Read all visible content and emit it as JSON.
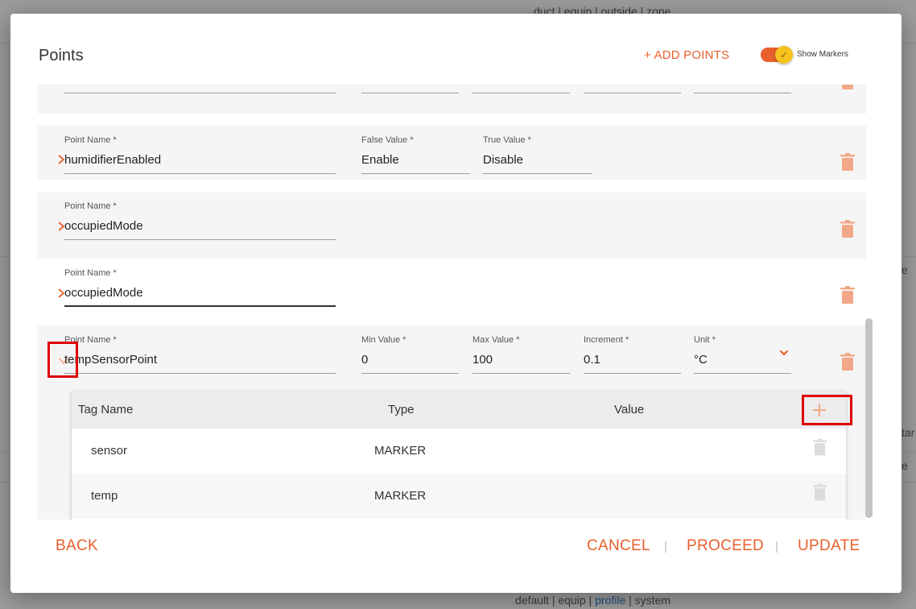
{
  "background": {
    "top_text": "duct | equip | outside | zone",
    "bottom_text_1": "default | equip | ",
    "bottom_link": "profile",
    "bottom_text_2": " | system",
    "right_fragment_1": "e",
    "right_fragment_2": "tar",
    "right_fragment_3": "e"
  },
  "modal": {
    "title": "Points",
    "add_points_label": "+ ADD POINTS",
    "show_markers_label": "Show Markers",
    "show_markers_on": true
  },
  "rows": [
    {
      "name_label": "Point Name *",
      "name_value": "humidifierEnabled",
      "false_label": "False Value *",
      "false_value": "Enable",
      "true_label": "True Value *",
      "true_value": "Disable"
    },
    {
      "name_label": "Point Name *",
      "name_value": "occupiedMode"
    },
    {
      "name_label": "Point Name *",
      "name_value": "occupiedMode"
    },
    {
      "name_label": "Point Name *",
      "name_value": "tempSensorPoint",
      "min_label": "Min Value *",
      "min_value": "0",
      "max_label": "Max Value *",
      "max_value": "100",
      "inc_label": "Increment *",
      "inc_value": "0.1",
      "unit_label": "Unit *",
      "unit_value": "°C"
    }
  ],
  "tag_table": {
    "headers": {
      "name": "Tag Name",
      "type": "Type",
      "value": "Value"
    },
    "tags": [
      {
        "name": "sensor",
        "type": "MARKER"
      },
      {
        "name": "temp",
        "type": "MARKER"
      }
    ]
  },
  "footer": {
    "back": "BACK",
    "cancel": "CANCEL",
    "proceed": "PROCEED",
    "update": "UPDATE",
    "separator": "|"
  },
  "colors": {
    "accent": "#e8602c",
    "toggle_knob": "#f6c21e",
    "highlight": "#e00000"
  }
}
